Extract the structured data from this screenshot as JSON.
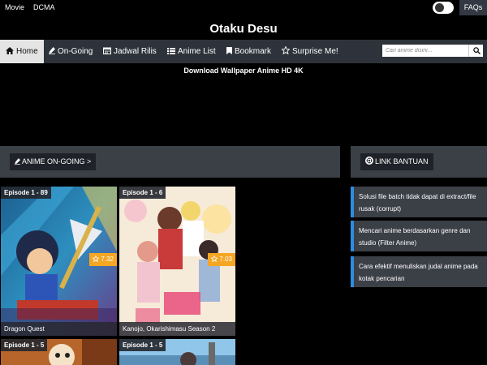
{
  "topbar": {
    "links": [
      "Movie",
      "DCMA"
    ],
    "faqs_label": "FAQs"
  },
  "site": {
    "title": "Otaku Desu"
  },
  "nav": {
    "items": [
      {
        "label": "Home",
        "icon": "home-icon"
      },
      {
        "label": "On-Going",
        "icon": "pencil-icon"
      },
      {
        "label": "Jadwal Rilis",
        "icon": "calendar-icon"
      },
      {
        "label": "Anime List",
        "icon": "list-icon"
      },
      {
        "label": "Bookmark",
        "icon": "bookmark-icon"
      },
      {
        "label": "Surprise Me!",
        "icon": "star-icon"
      }
    ],
    "active_index": 0
  },
  "search": {
    "placeholder": "Cari anime disini..."
  },
  "banner": {
    "text": "Download Wallpaper Anime HD 4K"
  },
  "ongoing_section": {
    "label": "ANIME ON-GOING >",
    "icon": "pencil-icon"
  },
  "help_section": {
    "label": "LINK BANTUAN",
    "icon": "lifebuoy-icon",
    "accent": "#2b8de3"
  },
  "cards": [
    {
      "episode": "Episode 1 - 89",
      "rating": "7.32",
      "title": "Dragon Quest"
    },
    {
      "episode": "Episode 1 - 6",
      "rating": "7.03",
      "title": "Kanojo, Okarishimasu Season 2"
    },
    {
      "episode": "Episode 1 - 5"
    },
    {
      "episode": "Episode 1 - 5"
    }
  ],
  "help_links": [
    "Solusi file batch tidak dapat di extract/file rusak (corrupt)",
    "Mencari anime berdasarkan genre dan studio (Filter Anime)",
    "Cara efektif menuliskan judal anime pada kotak pencarian"
  ],
  "colors": {
    "nav_bg": "#2e333b",
    "section_bg": "#3b3f46",
    "rating": "#f5a623",
    "accent": "#2b8de3"
  }
}
